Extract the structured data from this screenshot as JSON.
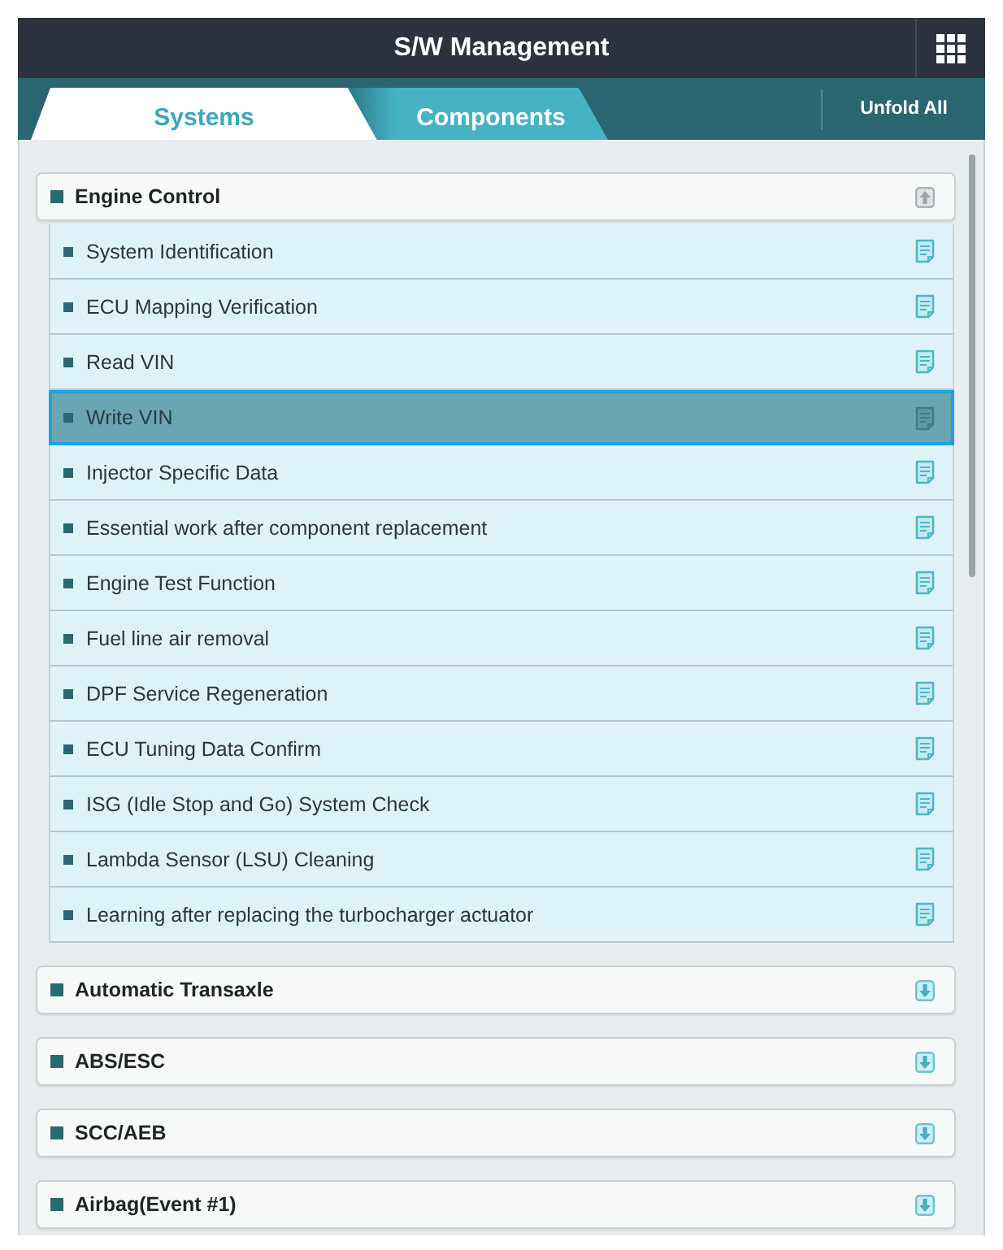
{
  "header": {
    "title": "S/W Management"
  },
  "tabs": [
    {
      "label": "Systems",
      "selected": true
    },
    {
      "label": "Components",
      "selected": false
    }
  ],
  "unfold_button": "Unfold All",
  "groups": [
    {
      "label": "Engine Control",
      "expanded": true,
      "items": [
        {
          "label": "System Identification",
          "selected": false
        },
        {
          "label": "ECU Mapping Verification",
          "selected": false
        },
        {
          "label": "Read VIN",
          "selected": false
        },
        {
          "label": "Write VIN",
          "selected": true
        },
        {
          "label": "Injector Specific Data",
          "selected": false
        },
        {
          "label": "Essential work after component replacement",
          "selected": false
        },
        {
          "label": "Engine Test Function",
          "selected": false
        },
        {
          "label": "Fuel line air removal",
          "selected": false
        },
        {
          "label": "DPF Service Regeneration",
          "selected": false
        },
        {
          "label": "ECU Tuning Data Confirm",
          "selected": false
        },
        {
          "label": "ISG (Idle Stop and Go) System Check",
          "selected": false
        },
        {
          "label": "Lambda Sensor (LSU) Cleaning",
          "selected": false
        },
        {
          "label": "Learning after replacing the turbocharger actuator",
          "selected": false
        }
      ]
    },
    {
      "label": "Automatic Transaxle",
      "expanded": false
    },
    {
      "label": "ABS/ESC",
      "expanded": false
    },
    {
      "label": "SCC/AEB",
      "expanded": false
    },
    {
      "label": "Airbag(Event #1)",
      "expanded": false
    }
  ]
}
